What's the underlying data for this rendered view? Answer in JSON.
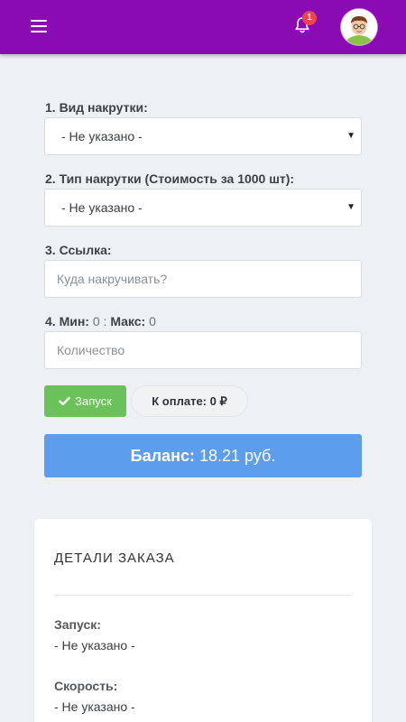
{
  "header": {
    "menu_icon": "hamburger-menu-icon",
    "bell_icon": "bell-icon",
    "notification_count": "1",
    "avatar_icon": "user-avatar",
    "bar_color": "#8a0ab3"
  },
  "form": {
    "type_label": "1. Вид накрутки:",
    "type_value": "- Не указано -",
    "kind_label": "2. Тип накрутки (Стоимость за 1000 шт):",
    "kind_value": "- Не указано -",
    "link_label": "3. Ссылка:",
    "link_placeholder": "Куда накручивать?",
    "minmax_min_label": "4. Мин:",
    "minmax_min_value": "0",
    "minmax_sep": ":",
    "minmax_max_label": "Макс:",
    "minmax_max_value": "0",
    "quantity_placeholder": "Количество",
    "launch_label": "Запуск",
    "pay_label": "К оплате: 0 ₽"
  },
  "balance": {
    "label": "Баланс:",
    "value": "18.21 руб.",
    "color": "#5c9ded"
  },
  "details": {
    "title": "ДЕТАЛИ ЗАКАЗА",
    "items": [
      {
        "label": "Запуск:",
        "value": "- Не указано -"
      },
      {
        "label": "Скорость:",
        "value": "- Не указано -"
      }
    ]
  }
}
